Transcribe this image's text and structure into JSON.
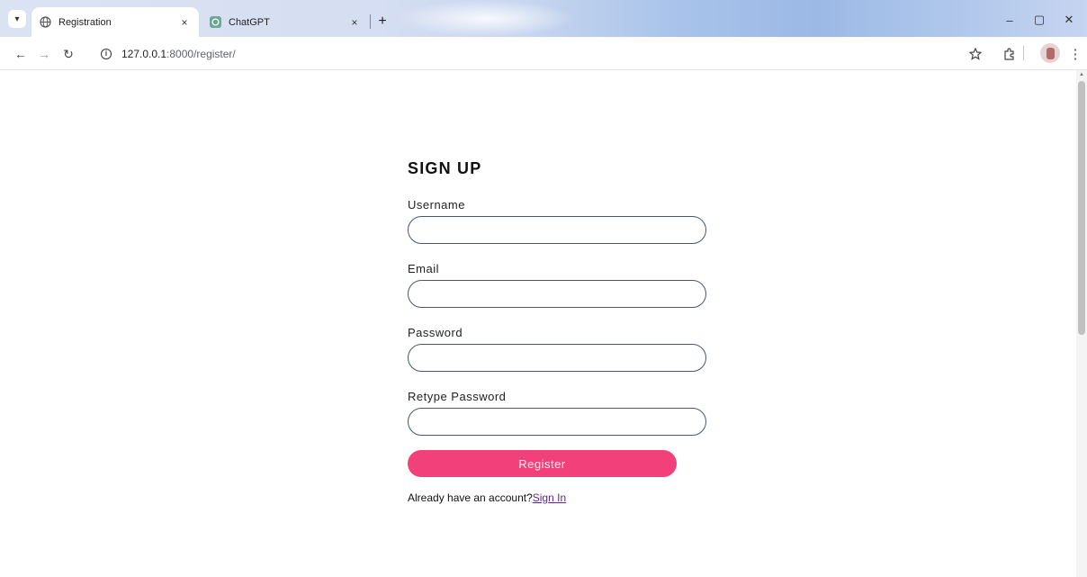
{
  "browser": {
    "tabs": [
      {
        "title": "Registration",
        "active": true,
        "icon": "globe-icon"
      },
      {
        "title": "ChatGPT",
        "active": false,
        "icon": "chatgpt-icon"
      }
    ],
    "new_tab_label": "+",
    "tab_close_label": "×",
    "url_host": "127.0.0.1",
    "url_rest": ":8000/register/",
    "window_controls": {
      "minimize": "–",
      "maximize": "▢",
      "close": "✕"
    },
    "nav_icons": {
      "back": "←",
      "forward": "→",
      "reload": "↻"
    }
  },
  "form": {
    "title": "SIGN UP",
    "fields": [
      {
        "label": "Username",
        "value": "",
        "placeholder": ""
      },
      {
        "label": "Email",
        "value": "",
        "placeholder": ""
      },
      {
        "label": "Password",
        "value": "",
        "placeholder": ""
      },
      {
        "label": "Retype Password",
        "value": "",
        "placeholder": ""
      }
    ],
    "submit_label": "Register",
    "signin_prompt": "Already have an account?",
    "signin_link": "Sign In"
  },
  "colors": {
    "accent": "#f2417a",
    "link": "#5b2a86",
    "input_border": "#4a5668"
  }
}
